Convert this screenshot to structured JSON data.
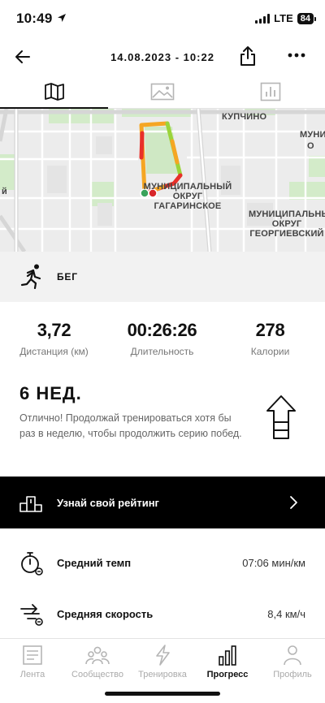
{
  "status": {
    "time": "10:49",
    "network": "LTE",
    "battery": "84"
  },
  "header": {
    "title": "14.08.2023 - 10:22"
  },
  "tabs": [
    {
      "name": "map",
      "icon": "map-icon",
      "active": true
    },
    {
      "name": "photos",
      "icon": "image-icon",
      "active": false
    },
    {
      "name": "charts",
      "icon": "bar-chart-icon",
      "active": false
    }
  ],
  "map": {
    "labels": {
      "kupchino": "КУПЧИНО",
      "muni_top": "МУНИ",
      "muni_top2": "О",
      "gagarinskoe_1": "МУНИЦИПАЛЬНЫЙ",
      "gagarinskoe_2": "ОКРУГ",
      "gagarinskoe_3": "ГАГАРИНСКОЕ",
      "georgievsky_1": "МУНИЦИПАЛЬНЫЙ",
      "georgievsky_2": "ОКРУГ",
      "georgievsky_3": "ГЕОРГИЕВСКИЙ",
      "left_edge": "й"
    }
  },
  "activity": {
    "label": "БЕГ",
    "icon": "running-icon"
  },
  "stats": [
    {
      "value": "3,72",
      "label": "Дистанция (км)"
    },
    {
      "value": "00:26:26",
      "label": "Длительность"
    },
    {
      "value": "278",
      "label": "Калории"
    }
  ],
  "streak": {
    "title": "6 НЕД.",
    "text": "Отлично! Продолжай тренироваться хотя бы раз в неделю, чтобы продолжить серию побед."
  },
  "ranking": {
    "label": "Узнай свой рейтинг"
  },
  "metrics": [
    {
      "label": "Средний темп",
      "value": "07:06 мин/км",
      "icon": "stopwatch-icon"
    },
    {
      "label": "Средняя скорость",
      "value": "8,4 км/ч",
      "icon": "speed-icon"
    }
  ],
  "nav": [
    {
      "label": "Лента",
      "icon": "feed-icon",
      "active": false
    },
    {
      "label": "Сообщество",
      "icon": "community-icon",
      "active": false
    },
    {
      "label": "Тренировка",
      "icon": "workout-icon",
      "active": false
    },
    {
      "label": "Прогресс",
      "icon": "progress-icon",
      "active": true
    },
    {
      "label": "Профиль",
      "icon": "profile-icon",
      "active": false
    }
  ],
  "colors": {
    "accent": "#000000",
    "route_fast": "#e8302a",
    "route_mid": "#f5a623",
    "route_slow": "#9bd43a",
    "start": "#3aa35c"
  }
}
